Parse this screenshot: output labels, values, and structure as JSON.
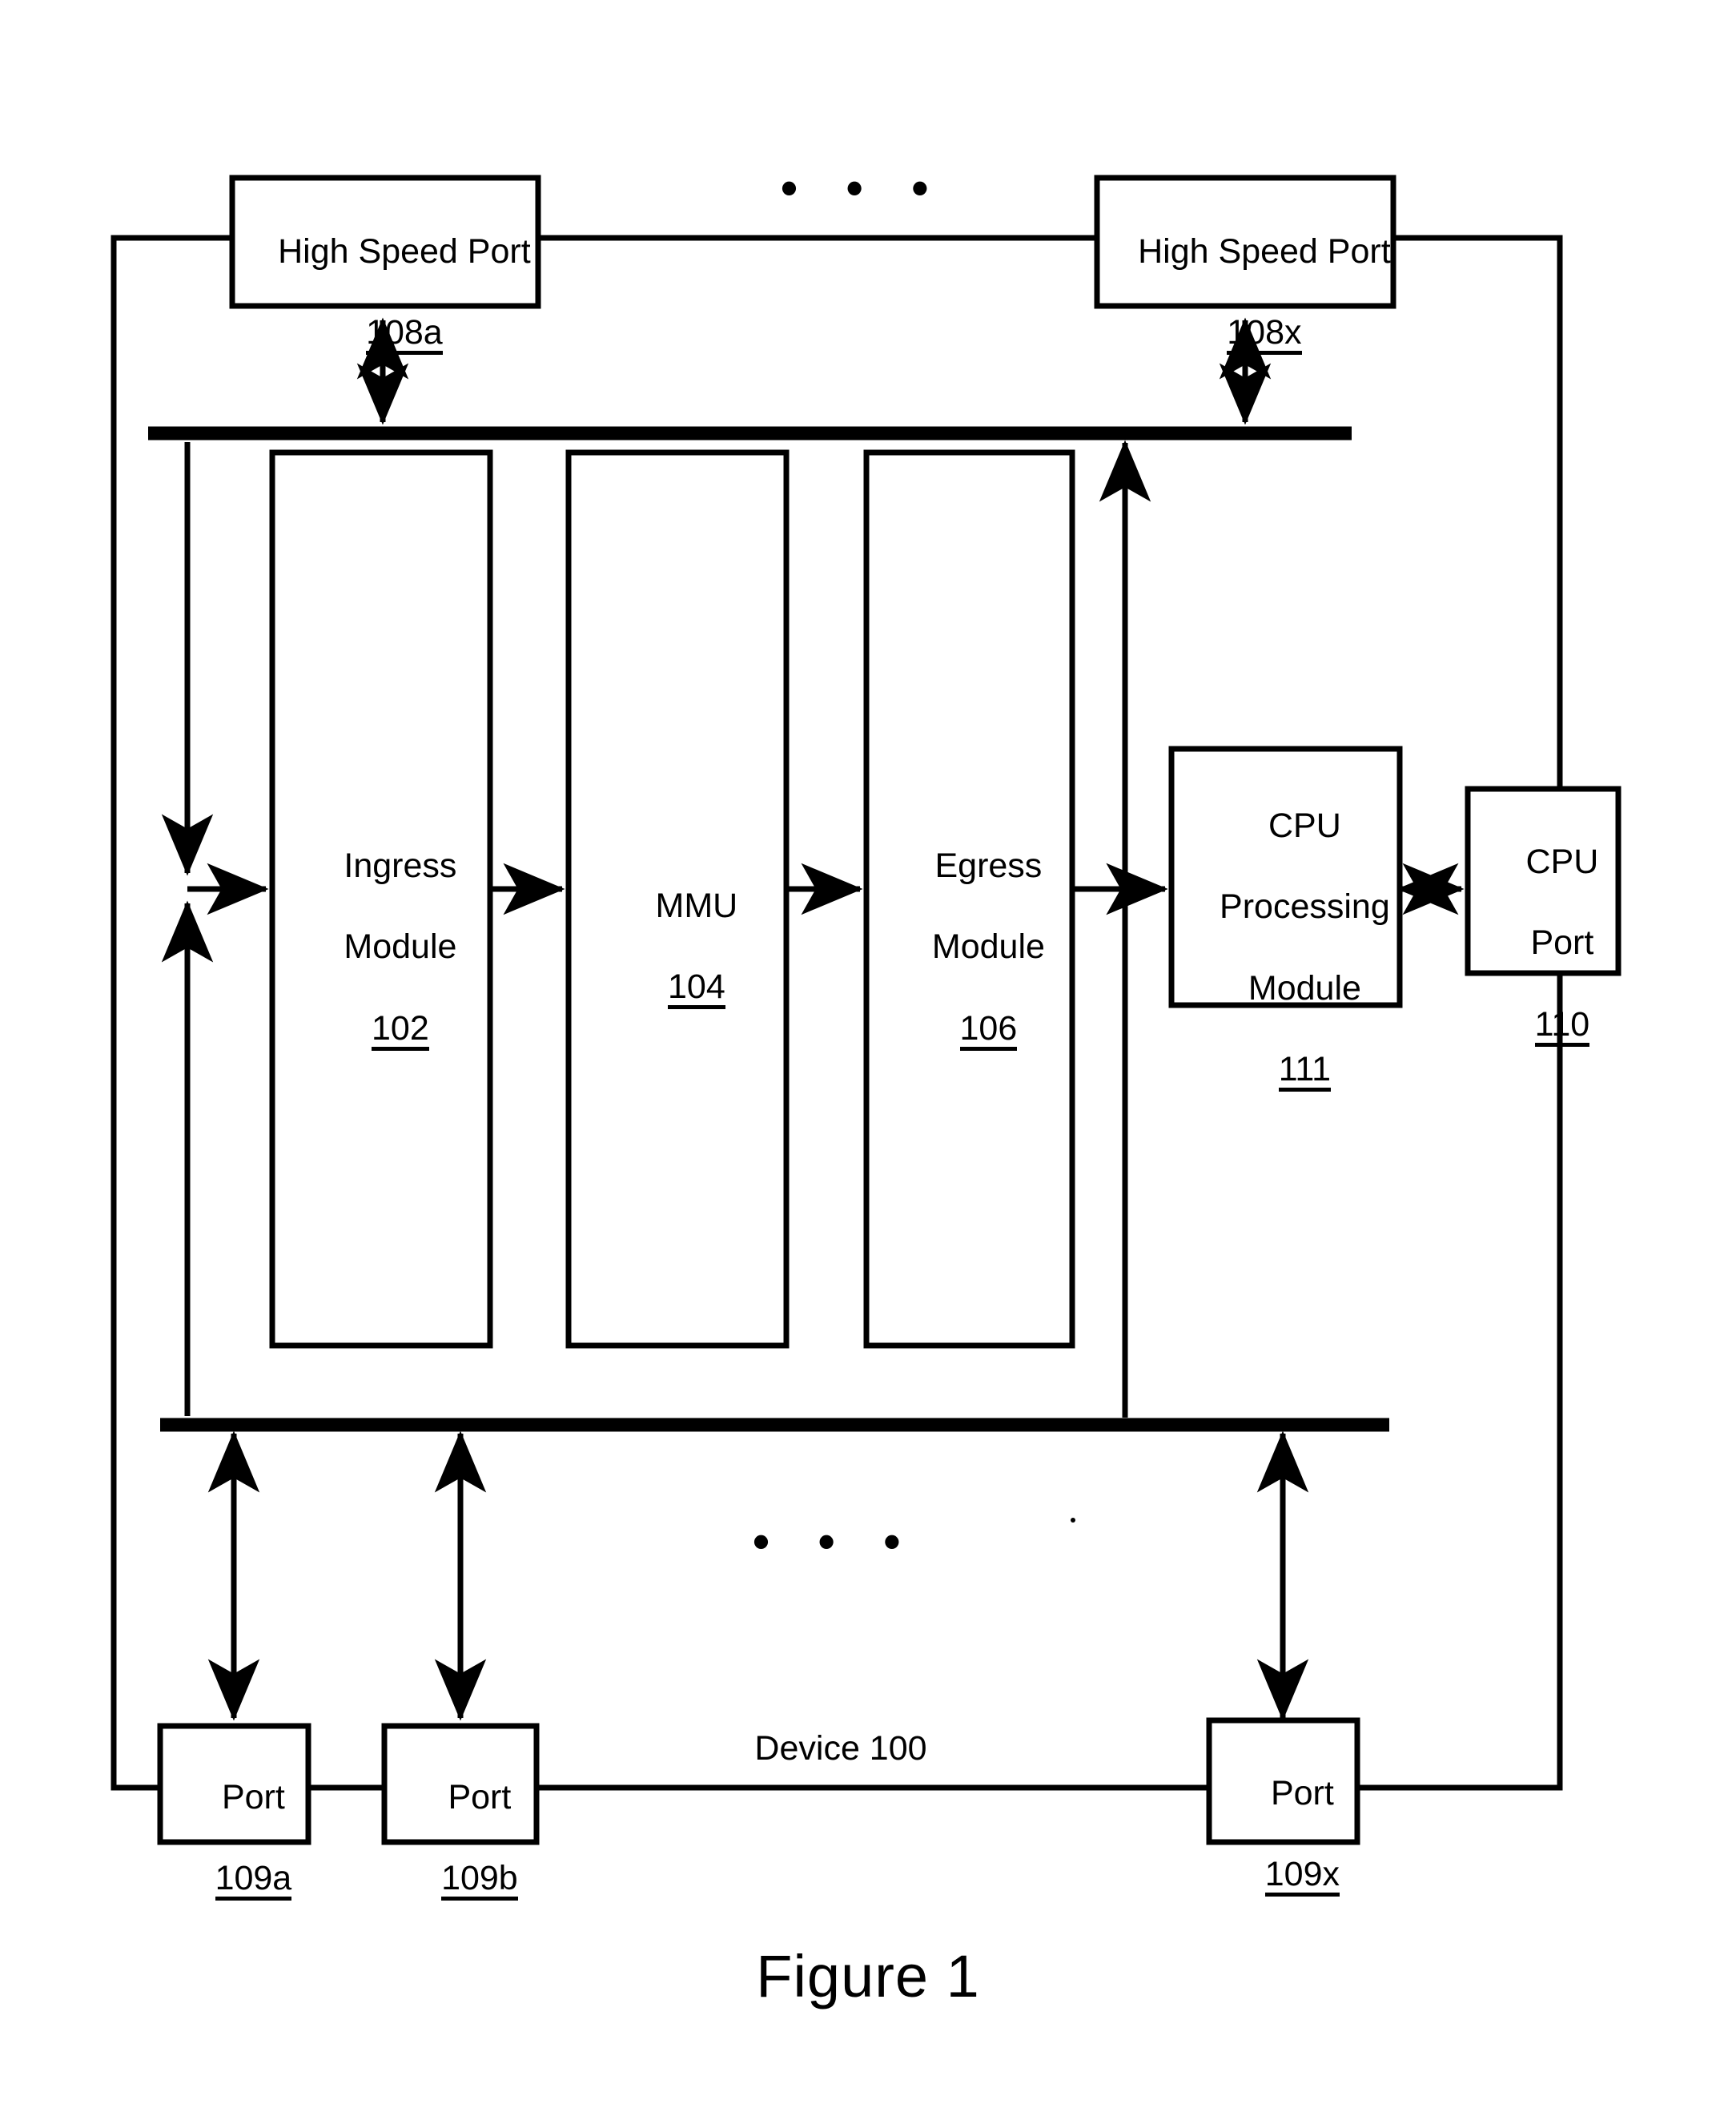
{
  "figure": {
    "caption": "Figure 1",
    "device_label": "Device 100",
    "ellipsis": "• • •"
  },
  "high_speed_ports": [
    {
      "name": "high-speed-port-108a",
      "title": "High Speed Port",
      "ref": "108a"
    },
    {
      "name": "high-speed-port-108x",
      "title": "High Speed Port",
      "ref": "108x"
    }
  ],
  "modules": [
    {
      "name": "ingress-module",
      "line1": "Ingress",
      "line2": "Module",
      "ref": "102"
    },
    {
      "name": "mmu-module",
      "line1": "MMU",
      "line2": "",
      "ref": "104"
    },
    {
      "name": "egress-module",
      "line1": "Egress",
      "line2": "Module",
      "ref": "106"
    },
    {
      "name": "cpu-processing-module",
      "line1": "CPU",
      "line2": "Processing",
      "line3": "Module",
      "ref": "111"
    },
    {
      "name": "cpu-port",
      "line1": "CPU",
      "line2": "Port",
      "ref": "110"
    }
  ],
  "ports": [
    {
      "name": "port-109a",
      "title": "Port",
      "ref": "109a"
    },
    {
      "name": "port-109b",
      "title": "Port",
      "ref": "109b"
    },
    {
      "name": "port-109x",
      "title": "Port",
      "ref": "109x"
    }
  ],
  "colors": {
    "stroke": "#000000",
    "background": "#ffffff"
  }
}
